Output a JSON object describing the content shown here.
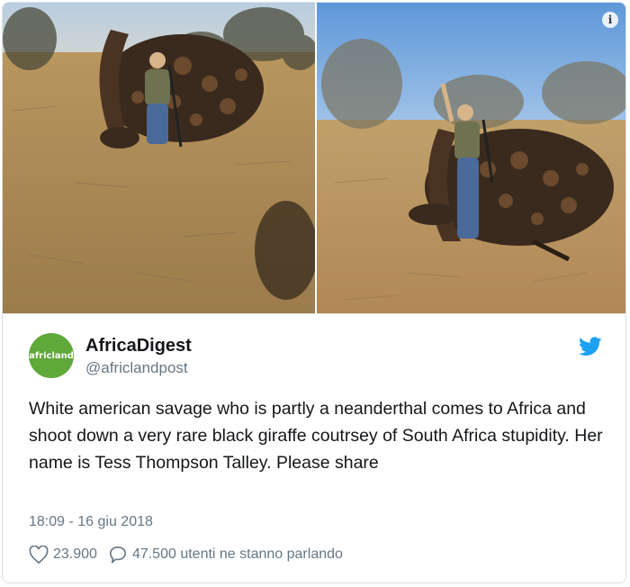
{
  "media": {
    "left_photo_label": "",
    "right_photo_label": "",
    "info_icon": "info-icon"
  },
  "tweet": {
    "avatar_text": "africland",
    "display_name": "AfricaDigest",
    "handle": "@africlandpost",
    "text": "White american savage who is partly a neanderthal comes to Africa and shoot down a very rare black giraffe coutrsey of South Africa stupidity. Her name is Tess Thompson Talley. Please share",
    "timestamp": "18:09 - 16 giu 2018",
    "likes": "23.900",
    "replies_label": "47.500 utenti ne stanno parlando",
    "icons": {
      "like": "heart-icon",
      "reply": "speech-bubble-icon",
      "brand": "twitter-bird-icon"
    },
    "colors": {
      "brand": "#1da1f2",
      "avatar": "#5fa83a",
      "muted": "#657786"
    }
  }
}
